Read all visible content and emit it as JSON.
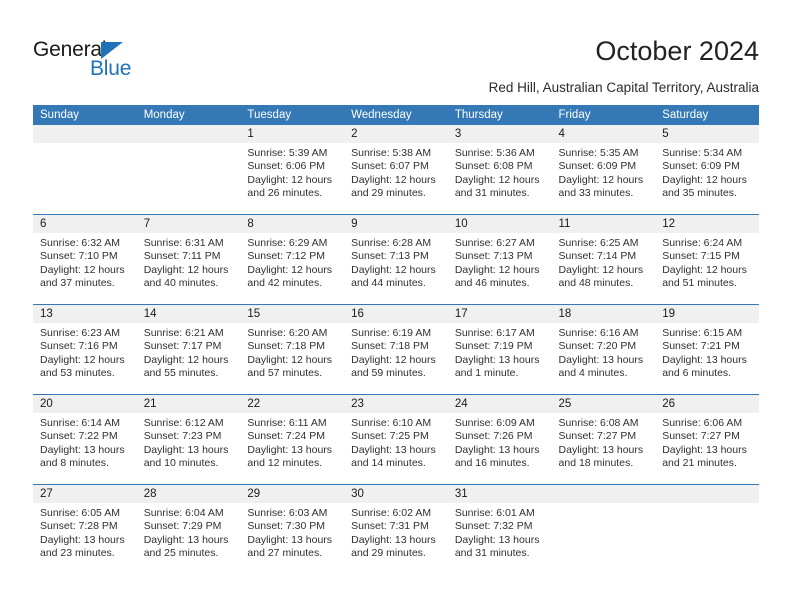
{
  "brand": {
    "name_dark": "General",
    "name_blue": "Blue",
    "accent_color": "#1f72b8"
  },
  "header": {
    "title": "October 2024",
    "subtitle": "Red Hill, Australian Capital Territory, Australia",
    "header_bg_color": "#3479b5",
    "daynum_bg_color": "#f0f0f0"
  },
  "calendar": {
    "weekday_headers": [
      "Sunday",
      "Monday",
      "Tuesday",
      "Wednesday",
      "Thursday",
      "Friday",
      "Saturday"
    ],
    "weeks": [
      [
        {
          "day": "",
          "empty": true,
          "sunrise": "",
          "sunset": "",
          "daylight1": "",
          "daylight2": ""
        },
        {
          "day": "",
          "empty": true,
          "sunrise": "",
          "sunset": "",
          "daylight1": "",
          "daylight2": ""
        },
        {
          "day": "1",
          "sunrise": "Sunrise: 5:39 AM",
          "sunset": "Sunset: 6:06 PM",
          "daylight1": "Daylight: 12 hours",
          "daylight2": "and 26 minutes."
        },
        {
          "day": "2",
          "sunrise": "Sunrise: 5:38 AM",
          "sunset": "Sunset: 6:07 PM",
          "daylight1": "Daylight: 12 hours",
          "daylight2": "and 29 minutes."
        },
        {
          "day": "3",
          "sunrise": "Sunrise: 5:36 AM",
          "sunset": "Sunset: 6:08 PM",
          "daylight1": "Daylight: 12 hours",
          "daylight2": "and 31 minutes."
        },
        {
          "day": "4",
          "sunrise": "Sunrise: 5:35 AM",
          "sunset": "Sunset: 6:09 PM",
          "daylight1": "Daylight: 12 hours",
          "daylight2": "and 33 minutes."
        },
        {
          "day": "5",
          "sunrise": "Sunrise: 5:34 AM",
          "sunset": "Sunset: 6:09 PM",
          "daylight1": "Daylight: 12 hours",
          "daylight2": "and 35 minutes."
        }
      ],
      [
        {
          "day": "6",
          "sunrise": "Sunrise: 6:32 AM",
          "sunset": "Sunset: 7:10 PM",
          "daylight1": "Daylight: 12 hours",
          "daylight2": "and 37 minutes."
        },
        {
          "day": "7",
          "sunrise": "Sunrise: 6:31 AM",
          "sunset": "Sunset: 7:11 PM",
          "daylight1": "Daylight: 12 hours",
          "daylight2": "and 40 minutes."
        },
        {
          "day": "8",
          "sunrise": "Sunrise: 6:29 AM",
          "sunset": "Sunset: 7:12 PM",
          "daylight1": "Daylight: 12 hours",
          "daylight2": "and 42 minutes."
        },
        {
          "day": "9",
          "sunrise": "Sunrise: 6:28 AM",
          "sunset": "Sunset: 7:13 PM",
          "daylight1": "Daylight: 12 hours",
          "daylight2": "and 44 minutes."
        },
        {
          "day": "10",
          "sunrise": "Sunrise: 6:27 AM",
          "sunset": "Sunset: 7:13 PM",
          "daylight1": "Daylight: 12 hours",
          "daylight2": "and 46 minutes."
        },
        {
          "day": "11",
          "sunrise": "Sunrise: 6:25 AM",
          "sunset": "Sunset: 7:14 PM",
          "daylight1": "Daylight: 12 hours",
          "daylight2": "and 48 minutes."
        },
        {
          "day": "12",
          "sunrise": "Sunrise: 6:24 AM",
          "sunset": "Sunset: 7:15 PM",
          "daylight1": "Daylight: 12 hours",
          "daylight2": "and 51 minutes."
        }
      ],
      [
        {
          "day": "13",
          "sunrise": "Sunrise: 6:23 AM",
          "sunset": "Sunset: 7:16 PM",
          "daylight1": "Daylight: 12 hours",
          "daylight2": "and 53 minutes."
        },
        {
          "day": "14",
          "sunrise": "Sunrise: 6:21 AM",
          "sunset": "Sunset: 7:17 PM",
          "daylight1": "Daylight: 12 hours",
          "daylight2": "and 55 minutes."
        },
        {
          "day": "15",
          "sunrise": "Sunrise: 6:20 AM",
          "sunset": "Sunset: 7:18 PM",
          "daylight1": "Daylight: 12 hours",
          "daylight2": "and 57 minutes."
        },
        {
          "day": "16",
          "sunrise": "Sunrise: 6:19 AM",
          "sunset": "Sunset: 7:18 PM",
          "daylight1": "Daylight: 12 hours",
          "daylight2": "and 59 minutes."
        },
        {
          "day": "17",
          "sunrise": "Sunrise: 6:17 AM",
          "sunset": "Sunset: 7:19 PM",
          "daylight1": "Daylight: 13 hours",
          "daylight2": "and 1 minute."
        },
        {
          "day": "18",
          "sunrise": "Sunrise: 6:16 AM",
          "sunset": "Sunset: 7:20 PM",
          "daylight1": "Daylight: 13 hours",
          "daylight2": "and 4 minutes."
        },
        {
          "day": "19",
          "sunrise": "Sunrise: 6:15 AM",
          "sunset": "Sunset: 7:21 PM",
          "daylight1": "Daylight: 13 hours",
          "daylight2": "and 6 minutes."
        }
      ],
      [
        {
          "day": "20",
          "sunrise": "Sunrise: 6:14 AM",
          "sunset": "Sunset: 7:22 PM",
          "daylight1": "Daylight: 13 hours",
          "daylight2": "and 8 minutes."
        },
        {
          "day": "21",
          "sunrise": "Sunrise: 6:12 AM",
          "sunset": "Sunset: 7:23 PM",
          "daylight1": "Daylight: 13 hours",
          "daylight2": "and 10 minutes."
        },
        {
          "day": "22",
          "sunrise": "Sunrise: 6:11 AM",
          "sunset": "Sunset: 7:24 PM",
          "daylight1": "Daylight: 13 hours",
          "daylight2": "and 12 minutes."
        },
        {
          "day": "23",
          "sunrise": "Sunrise: 6:10 AM",
          "sunset": "Sunset: 7:25 PM",
          "daylight1": "Daylight: 13 hours",
          "daylight2": "and 14 minutes."
        },
        {
          "day": "24",
          "sunrise": "Sunrise: 6:09 AM",
          "sunset": "Sunset: 7:26 PM",
          "daylight1": "Daylight: 13 hours",
          "daylight2": "and 16 minutes."
        },
        {
          "day": "25",
          "sunrise": "Sunrise: 6:08 AM",
          "sunset": "Sunset: 7:27 PM",
          "daylight1": "Daylight: 13 hours",
          "daylight2": "and 18 minutes."
        },
        {
          "day": "26",
          "sunrise": "Sunrise: 6:06 AM",
          "sunset": "Sunset: 7:27 PM",
          "daylight1": "Daylight: 13 hours",
          "daylight2": "and 21 minutes."
        }
      ],
      [
        {
          "day": "27",
          "sunrise": "Sunrise: 6:05 AM",
          "sunset": "Sunset: 7:28 PM",
          "daylight1": "Daylight: 13 hours",
          "daylight2": "and 23 minutes."
        },
        {
          "day": "28",
          "sunrise": "Sunrise: 6:04 AM",
          "sunset": "Sunset: 7:29 PM",
          "daylight1": "Daylight: 13 hours",
          "daylight2": "and 25 minutes."
        },
        {
          "day": "29",
          "sunrise": "Sunrise: 6:03 AM",
          "sunset": "Sunset: 7:30 PM",
          "daylight1": "Daylight: 13 hours",
          "daylight2": "and 27 minutes."
        },
        {
          "day": "30",
          "sunrise": "Sunrise: 6:02 AM",
          "sunset": "Sunset: 7:31 PM",
          "daylight1": "Daylight: 13 hours",
          "daylight2": "and 29 minutes."
        },
        {
          "day": "31",
          "sunrise": "Sunrise: 6:01 AM",
          "sunset": "Sunset: 7:32 PM",
          "daylight1": "Daylight: 13 hours",
          "daylight2": "and 31 minutes."
        },
        {
          "day": "",
          "empty": true,
          "sunrise": "",
          "sunset": "",
          "daylight1": "",
          "daylight2": ""
        },
        {
          "day": "",
          "empty": true,
          "sunrise": "",
          "sunset": "",
          "daylight1": "",
          "daylight2": ""
        }
      ]
    ]
  }
}
